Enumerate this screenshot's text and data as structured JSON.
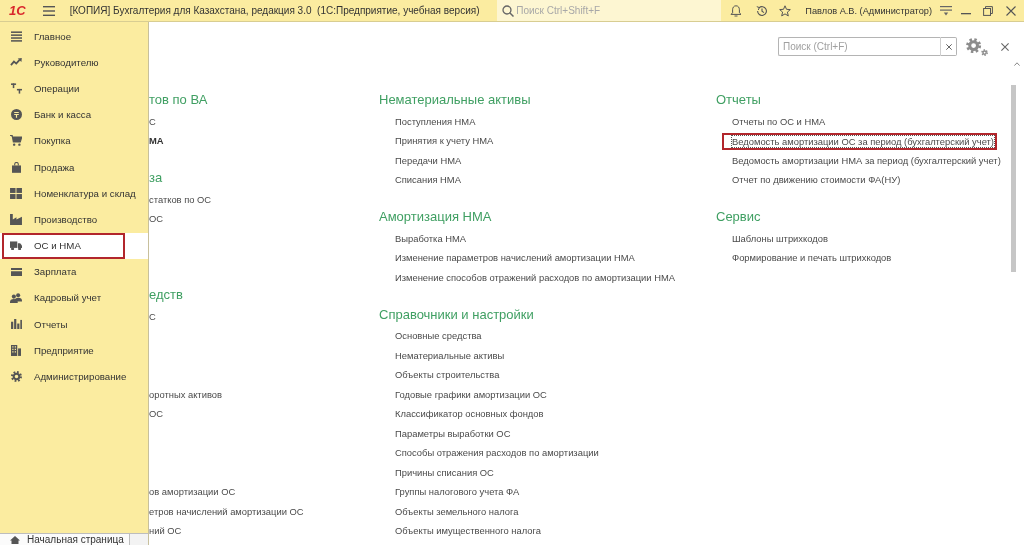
{
  "title_bar": {
    "logo": "1С",
    "title": "[КОПИЯ] Бухгалтерия для Казахстана, редакция 3.0  (1С:Предприятие, учебная версия)",
    "search": {
      "placeholder": "Поиск Ctrl+Shift+F"
    },
    "user": "Павлов А.В. (Администратор)"
  },
  "sidebar": {
    "items": [
      {
        "label": "Главное",
        "selected": false
      },
      {
        "label": "Руководителю",
        "selected": false
      },
      {
        "label": "Операции",
        "selected": false
      },
      {
        "label": "Банк и касса",
        "selected": false
      },
      {
        "label": "Покупка",
        "selected": false
      },
      {
        "label": "Продажа",
        "selected": false
      },
      {
        "label": "Номенклатура и склад",
        "selected": false
      },
      {
        "label": "Производство",
        "selected": false
      },
      {
        "label": "ОС и НМА",
        "selected": true
      },
      {
        "label": "Зарплата",
        "selected": false
      },
      {
        "label": "Кадровый учет",
        "selected": false
      },
      {
        "label": "Отчеты",
        "selected": false
      },
      {
        "label": "Предприятие",
        "selected": false
      },
      {
        "label": "Администрирование",
        "selected": false
      }
    ],
    "home_tab": "Начальная страница"
  },
  "content": {
    "search": {
      "placeholder": "Поиск (Ctrl+F)"
    },
    "columns": [
      {
        "sections": [
          {
            "heading": "тов по ВА",
            "items": [
              {
                "kind": "link",
                "label": "С",
                "bold": false,
                "focused": false
              },
              {
                "kind": "link",
                "label": "МА",
                "bold": true,
                "focused": false
              }
            ]
          },
          {
            "heading": "за",
            "items": [
              {
                "kind": "link",
                "label": "статков по ОС",
                "bold": false,
                "focused": false
              },
              {
                "kind": "link",
                "label": "ОС",
                "bold": false,
                "focused": false
              },
              {
                "kind": "covered"
              },
              {
                "kind": "covered"
              }
            ]
          },
          {
            "heading": "едств",
            "items": [
              {
                "kind": "link",
                "label": "С",
                "bold": false,
                "focused": false
              },
              {
                "kind": "covered"
              },
              {
                "kind": "covered"
              },
              {
                "kind": "covered"
              },
              {
                "kind": "link",
                "label": "оротных активов",
                "bold": false,
                "focused": false
              },
              {
                "kind": "link",
                "label": "ОС",
                "bold": false,
                "focused": false
              },
              {
                "kind": "covered"
              },
              {
                "kind": "covered"
              },
              {
                "kind": "covered"
              },
              {
                "kind": "link",
                "label": "ов амортизации ОС",
                "bold": false,
                "focused": false
              },
              {
                "kind": "link",
                "label": "етров начислений амортизации ОС",
                "bold": false,
                "focused": false
              },
              {
                "kind": "link",
                "label": "ний ОС",
                "bold": false,
                "focused": false
              }
            ]
          }
        ]
      },
      {
        "sections": [
          {
            "heading": "Нематериальные активы",
            "items": [
              {
                "kind": "link",
                "label": "Поступления НМА",
                "focused": false
              },
              {
                "kind": "link",
                "label": "Принятия к учету НМА",
                "focused": false
              },
              {
                "kind": "link",
                "label": "Передачи НМА",
                "focused": false
              },
              {
                "kind": "link",
                "label": "Списания НМА",
                "focused": false
              }
            ]
          },
          {
            "heading": "Амортизация НМА",
            "items": [
              {
                "kind": "link",
                "label": "Выработка НМА",
                "focused": false
              },
              {
                "kind": "link",
                "label": "Изменение параметров начислений амортизации НМА",
                "focused": false
              },
              {
                "kind": "link",
                "label": "Изменение способов отражений расходов по амортизации НМА",
                "focused": false
              }
            ]
          },
          {
            "heading": "Справочники и настройки",
            "items": [
              {
                "kind": "link",
                "label": "Основные средства",
                "focused": false
              },
              {
                "kind": "link",
                "label": "Нематериальные активы",
                "focused": false
              },
              {
                "kind": "link",
                "label": "Объекты строительства",
                "focused": false
              },
              {
                "kind": "link",
                "label": "Годовые графики амортизации ОС",
                "focused": false
              },
              {
                "kind": "link",
                "label": "Классификатор основных фондов",
                "focused": false
              },
              {
                "kind": "link",
                "label": "Параметры выработки ОС",
                "focused": false
              },
              {
                "kind": "link",
                "label": "Способы отражения расходов по амортизации",
                "focused": false
              },
              {
                "kind": "link",
                "label": "Причины списания ОС",
                "focused": false
              },
              {
                "kind": "link",
                "label": "Группы налогового учета ФА",
                "focused": false
              },
              {
                "kind": "link",
                "label": "Объекты земельного налога",
                "focused": false
              },
              {
                "kind": "link",
                "label": "Объекты имущественного налога",
                "focused": false
              }
            ]
          }
        ]
      },
      {
        "sections": [
          {
            "heading": "Отчеты",
            "items": [
              {
                "kind": "link",
                "label": "Отчеты по ОС и НМА",
                "focused": false
              },
              {
                "kind": "link",
                "label": "Ведомость амортизации ОС за период (бухгалтерский учет)",
                "focused": true
              },
              {
                "kind": "link",
                "label": "Ведомость амортизации НМА за период (бухгалтерский учет)",
                "focused": false
              },
              {
                "kind": "link",
                "label": "Отчет по движению стоимости ФА(НУ)",
                "focused": false
              }
            ]
          },
          {
            "heading": "Сервис",
            "items": [
              {
                "kind": "link",
                "label": "Шаблоны штрихкодов",
                "focused": false
              },
              {
                "kind": "link",
                "label": "Формирование и печать штрихкодов",
                "focused": false
              }
            ]
          }
        ]
      }
    ]
  }
}
